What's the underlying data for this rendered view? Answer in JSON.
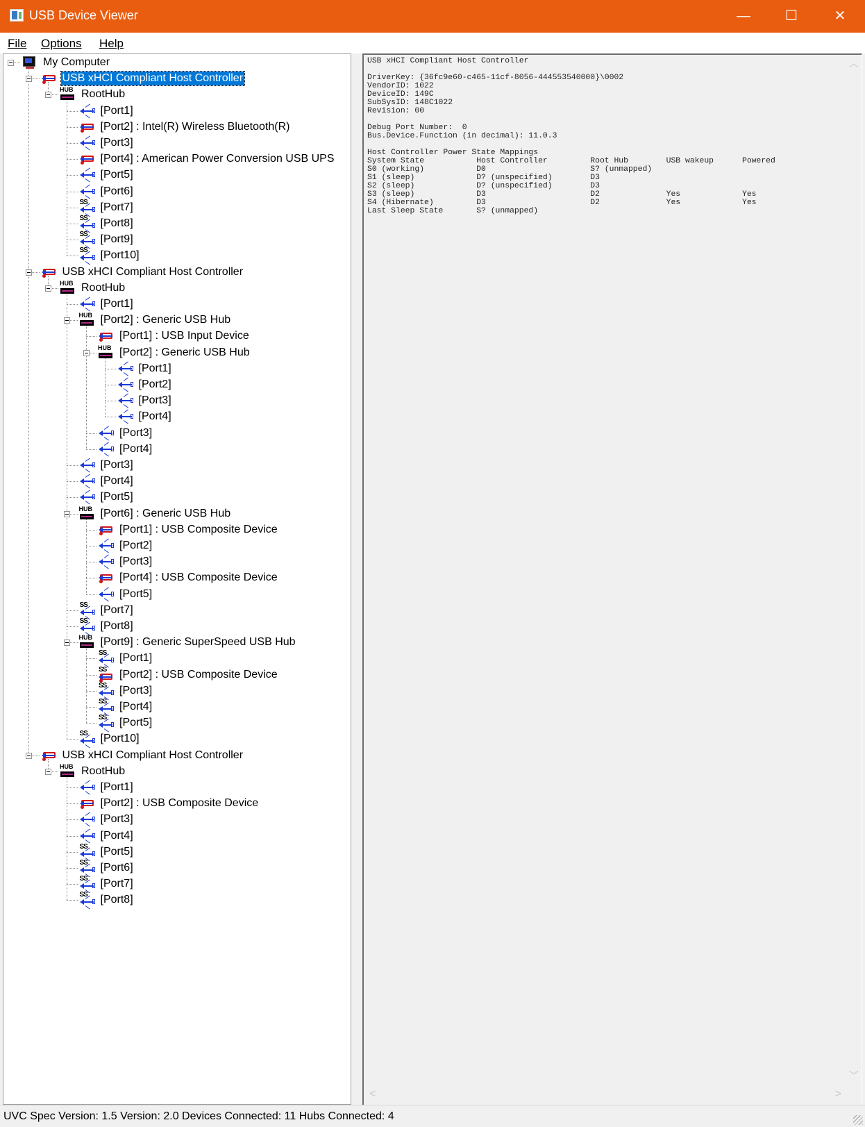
{
  "window": {
    "title": "USB Device Viewer",
    "minimize_glyph": "—",
    "maximize_glyph": "☐",
    "close_glyph": "✕",
    "titlebar_color": "#e85d10",
    "selection_color": "#0078d7"
  },
  "menu": {
    "file": "File",
    "options": "Options",
    "help": "Help"
  },
  "tree": [
    {
      "label": "My Computer",
      "icon": "computer-icon",
      "level": 0
    },
    {
      "label": "USB xHCI Compliant Host Controller",
      "icon": "usb-device-icon",
      "level": 1,
      "selected": true
    },
    {
      "label": "RootHub",
      "icon": "hub-icon",
      "level": 2
    },
    {
      "label": "[Port1]",
      "icon": "usb-port-icon",
      "level": 3
    },
    {
      "label": "[Port2]  :  Intel(R) Wireless Bluetooth(R)",
      "icon": "usb-device-icon",
      "level": 3
    },
    {
      "label": "[Port3]",
      "icon": "usb-port-icon",
      "level": 3
    },
    {
      "label": "[Port4]  :  American Power Conversion USB UPS",
      "icon": "usb-device-icon",
      "level": 3
    },
    {
      "label": "[Port5]",
      "icon": "usb-port-icon",
      "level": 3
    },
    {
      "label": "[Port6]",
      "icon": "usb-port-icon",
      "level": 3
    },
    {
      "label": "[Port7]",
      "icon": "superspeed-port-icon",
      "level": 3
    },
    {
      "label": "[Port8]",
      "icon": "superspeed-port-icon",
      "level": 3
    },
    {
      "label": "[Port9]",
      "icon": "superspeed-port-icon",
      "level": 3
    },
    {
      "label": "[Port10]",
      "icon": "superspeed-port-icon",
      "level": 3
    },
    {
      "label": "USB xHCI Compliant Host Controller",
      "icon": "usb-device-icon",
      "level": 1
    },
    {
      "label": "RootHub",
      "icon": "hub-icon",
      "level": 2
    },
    {
      "label": "[Port1]",
      "icon": "usb-port-icon",
      "level": 3
    },
    {
      "label": "[Port2]  :  Generic USB Hub",
      "icon": "hub-icon",
      "level": 3
    },
    {
      "label": "[Port1]  :  USB Input Device",
      "icon": "usb-device-icon",
      "level": 4
    },
    {
      "label": "[Port2]  :  Generic USB Hub",
      "icon": "hub-icon",
      "level": 4
    },
    {
      "label": "[Port1]",
      "icon": "usb-port-icon",
      "level": 5
    },
    {
      "label": "[Port2]",
      "icon": "usb-port-icon",
      "level": 5
    },
    {
      "label": "[Port3]",
      "icon": "usb-port-icon",
      "level": 5
    },
    {
      "label": "[Port4]",
      "icon": "usb-port-icon",
      "level": 5
    },
    {
      "label": "[Port3]",
      "icon": "usb-port-icon",
      "level": 4
    },
    {
      "label": "[Port4]",
      "icon": "usb-port-icon",
      "level": 4
    },
    {
      "label": "[Port3]",
      "icon": "usb-port-icon",
      "level": 3
    },
    {
      "label": "[Port4]",
      "icon": "usb-port-icon",
      "level": 3
    },
    {
      "label": "[Port5]",
      "icon": "usb-port-icon",
      "level": 3
    },
    {
      "label": "[Port6]  :  Generic USB Hub",
      "icon": "hub-icon",
      "level": 3
    },
    {
      "label": "[Port1]  :  USB Composite Device",
      "icon": "usb-device-icon",
      "level": 4
    },
    {
      "label": "[Port2]",
      "icon": "usb-port-icon",
      "level": 4
    },
    {
      "label": "[Port3]",
      "icon": "usb-port-icon",
      "level": 4
    },
    {
      "label": "[Port4]  :  USB Composite Device",
      "icon": "usb-device-icon",
      "level": 4
    },
    {
      "label": "[Port5]",
      "icon": "usb-port-icon",
      "level": 4
    },
    {
      "label": "[Port7]",
      "icon": "superspeed-port-icon",
      "level": 3
    },
    {
      "label": "[Port8]",
      "icon": "superspeed-port-icon",
      "level": 3
    },
    {
      "label": "[Port9]  :  Generic SuperSpeed USB Hub",
      "icon": "hub-icon",
      "level": 3
    },
    {
      "label": "[Port1]",
      "icon": "superspeed-port-icon",
      "level": 4
    },
    {
      "label": "[Port2]  :  USB Composite Device",
      "icon": "superspeed-device-icon",
      "level": 4
    },
    {
      "label": "[Port3]",
      "icon": "superspeed-port-icon",
      "level": 4
    },
    {
      "label": "[Port4]",
      "icon": "superspeed-port-icon",
      "level": 4
    },
    {
      "label": "[Port5]",
      "icon": "superspeed-port-icon",
      "level": 4
    },
    {
      "label": "[Port10]",
      "icon": "superspeed-port-icon",
      "level": 3
    },
    {
      "label": "USB xHCI Compliant Host Controller",
      "icon": "usb-device-icon",
      "level": 1
    },
    {
      "label": "RootHub",
      "icon": "hub-icon",
      "level": 2
    },
    {
      "label": "[Port1]",
      "icon": "usb-port-icon",
      "level": 3
    },
    {
      "label": "[Port2]  :  USB Composite Device",
      "icon": "usb-device-icon",
      "level": 3
    },
    {
      "label": "[Port3]",
      "icon": "usb-port-icon",
      "level": 3
    },
    {
      "label": "[Port4]",
      "icon": "usb-port-icon",
      "level": 3
    },
    {
      "label": "[Port5]",
      "icon": "superspeed-port-icon",
      "level": 3
    },
    {
      "label": "[Port6]",
      "icon": "superspeed-port-icon",
      "level": 3
    },
    {
      "label": "[Port7]",
      "icon": "superspeed-port-icon",
      "level": 3
    },
    {
      "label": "[Port8]",
      "icon": "superspeed-port-icon",
      "level": 3
    }
  ],
  "details": {
    "text": "USB xHCI Compliant Host Controller\n\nDriverKey: {36fc9e60-c465-11cf-8056-444553540000}\\0002\nVendorID: 1022\nDeviceID: 149C\nSubSysID: 148C1022\nRevision: 00\n\nDebug Port Number:  0\nBus.Device.Function (in decimal): 11.0.3\n\nHost Controller Power State Mappings\nSystem State           Host Controller         Root Hub        USB wakeup      Powered\nS0 (working)           D0                      S? (unmapped)\nS1 (sleep)             D? (unspecified)        D3\nS2 (sleep)             D? (unspecified)        D3\nS3 (sleep)             D3                      D2              Yes             Yes\nS4 (Hibernate)         D3                      D2              Yes             Yes\nLast Sleep State       S? (unmapped)"
  },
  "scroll": {
    "up": "︿",
    "down": "﹀",
    "left": "<",
    "right": ">"
  },
  "status": "UVC Spec Version: 1.5 Version: 2.0 Devices Connected: 11   Hubs Connected: 4"
}
